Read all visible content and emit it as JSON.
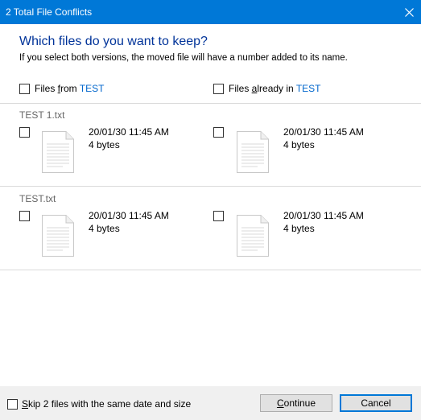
{
  "window": {
    "title": "2 Total File Conflicts"
  },
  "heading": "Which files do you want to keep?",
  "subtext": "If you select both versions, the moved file will have a number added to its name.",
  "columns": {
    "source_prefix": "Files ",
    "source_accel": "f",
    "source_mid": "rom ",
    "source_folder": "TEST",
    "dest_prefix": "Files ",
    "dest_accel": "a",
    "dest_mid": "lready in ",
    "dest_folder": "TEST"
  },
  "conflicts": [
    {
      "name": "TEST 1.txt",
      "source": {
        "date": "20/01/30 11:45 AM",
        "size": "4 bytes"
      },
      "dest": {
        "date": "20/01/30 11:45 AM",
        "size": "4 bytes"
      }
    },
    {
      "name": "TEST.txt",
      "source": {
        "date": "20/01/30 11:45 AM",
        "size": "4 bytes"
      },
      "dest": {
        "date": "20/01/30 11:45 AM",
        "size": "4 bytes"
      }
    }
  ],
  "footer": {
    "skip_accel": "S",
    "skip_rest": "kip 2 files with the same date and size",
    "continue_accel": "C",
    "continue_rest": "ontinue",
    "cancel_label": "Cancel"
  },
  "icons": {
    "close": "close-icon",
    "file": "text-file-icon"
  },
  "colors": {
    "titlebar": "#0078d7",
    "heading": "#003399",
    "link": "#0066cc"
  }
}
